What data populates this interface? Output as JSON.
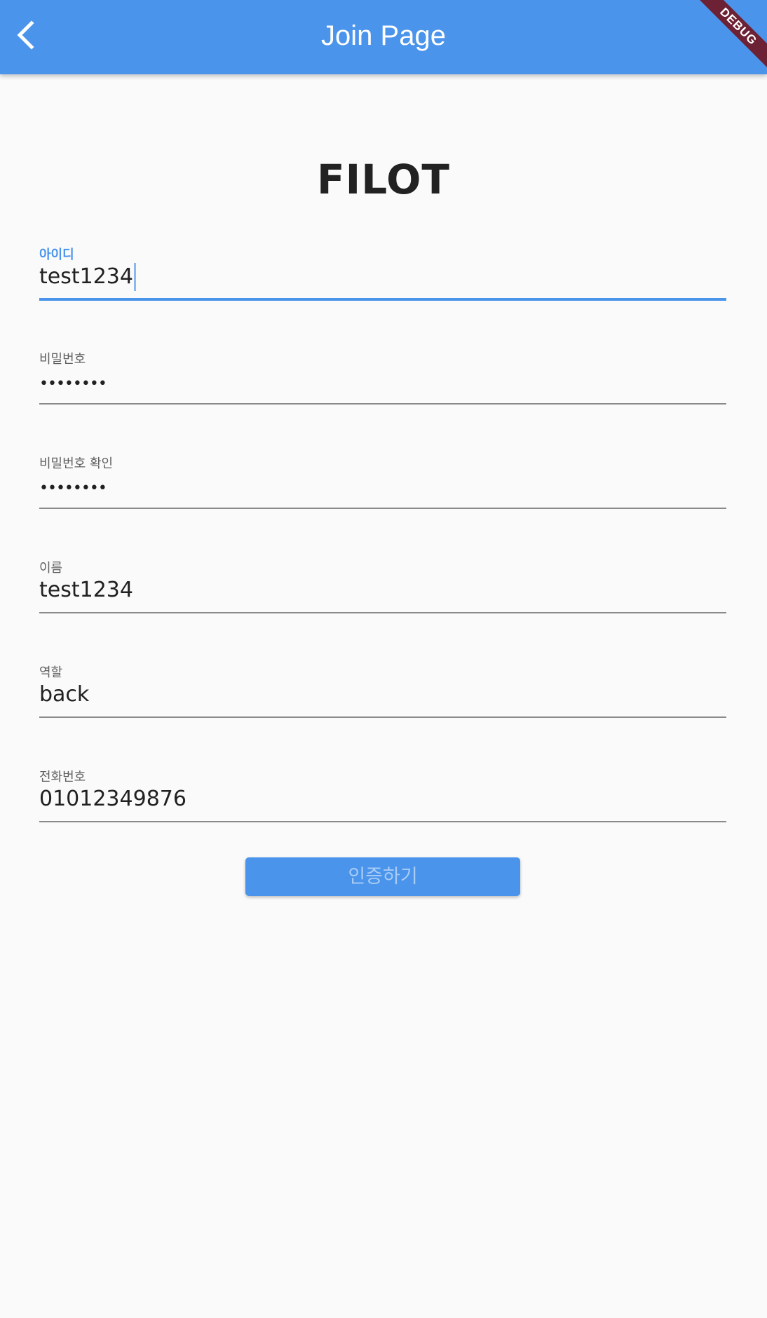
{
  "appbar": {
    "title": "Join Page",
    "back_icon": "chevron-left-icon",
    "color": "#4a94eb",
    "debug_label": "DEBUG"
  },
  "logo": {
    "text": "FILOT"
  },
  "form": {
    "fields": [
      {
        "label": "아이디",
        "value": "test1234",
        "focused": true
      },
      {
        "label": "비밀번호",
        "value": "••••••••",
        "obscured": true
      },
      {
        "label": "비밀번호 확인",
        "value": "••••••••",
        "obscured": true
      },
      {
        "label": "이름",
        "value": "test1234"
      },
      {
        "label": "역할",
        "value": "back"
      },
      {
        "label": "전화번호",
        "value": "01012349876"
      }
    ],
    "submit_label": "인증하기"
  }
}
